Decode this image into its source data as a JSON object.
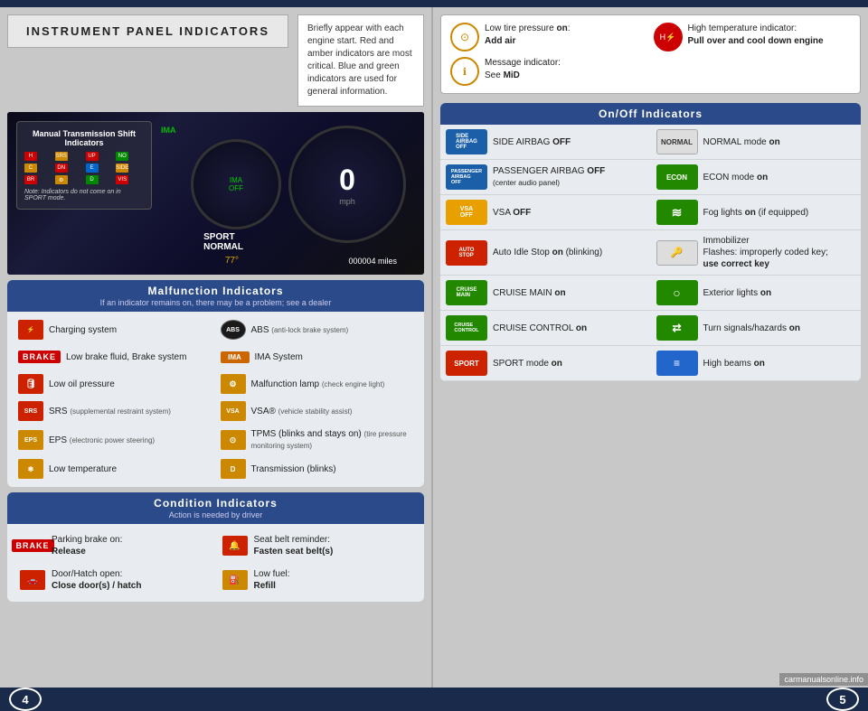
{
  "page": {
    "title": "INSTRUMENT PANEL INDICATORS",
    "note_text": "Briefly appear with each engine start. Red and amber indicators are most critical. Blue and green indicators are used for general information.",
    "page_left": "4",
    "page_right": "5"
  },
  "dashboard": {
    "overlay_title": "Manual Transmission Shift Indicators",
    "overlay_note": "Note: Indicators do not come on in SPORT mode.",
    "speed": "0",
    "speed_unit": "mph",
    "odometer": "000004"
  },
  "malfunction": {
    "section_title": "Malfunction Indicators",
    "section_subtitle": "If an indicator remains on, there may be a problem; see a dealer",
    "items_left": [
      {
        "label": "Charging system",
        "icon_type": "red-box"
      },
      {
        "label": "Low brake fluid, Brake system",
        "icon_type": "brake-badge"
      },
      {
        "label": "Low oil pressure",
        "icon_type": "red-oil"
      },
      {
        "label": "SRS",
        "sublabel": "(supplemental restraint system)",
        "icon_type": "red-srs"
      },
      {
        "label": "EPS",
        "sublabel": "(electronic power steering)",
        "icon_type": "amber-eps"
      },
      {
        "label": "Low temperature",
        "icon_type": "amber-temp"
      }
    ],
    "items_right": [
      {
        "label": "ABS",
        "sublabel": "(anti-lock brake system)",
        "icon_type": "abs-circle"
      },
      {
        "label": "IMA System",
        "icon_type": "ima-badge"
      },
      {
        "label": "Malfunction lamp",
        "sublabel": "(check engine light)",
        "icon_type": "amber-engine"
      },
      {
        "label": "VSA®",
        "sublabel": "(vehicle stability assist)",
        "icon_type": "amber-vsa"
      },
      {
        "label": "TPMS (blinks and stays on)",
        "sublabel": "(tire pressure monitoring system)",
        "icon_type": "amber-tpms"
      },
      {
        "label": "Transmission (blinks)",
        "icon_type": "amber-trans"
      }
    ]
  },
  "condition": {
    "section_title": "Condition Indicators",
    "section_subtitle": "Action is needed by driver",
    "items_left": [
      {
        "label": "Parking brake on:",
        "sublabel": "Release",
        "icon_type": "brake-badge"
      },
      {
        "label": "Door/Hatch open:",
        "sublabel": "Close door(s) / hatch",
        "icon_type": "door-icon"
      }
    ],
    "items_right": [
      {
        "label": "Seat belt reminder:",
        "sublabel": "Fasten seat belt(s)",
        "icon_type": "seatbelt-icon"
      },
      {
        "label": "Low fuel:",
        "sublabel": "Refill",
        "icon_type": "fuel-icon"
      }
    ]
  },
  "top_right": {
    "items": [
      {
        "label": "Low tire pressure on: Add air",
        "icon_type": "tire-amber"
      },
      {
        "label": "High temperature indicator: Pull over and cool down engine",
        "icon_type": "temp-red"
      },
      {
        "label": "Message indicator: See MiD",
        "icon_type": "info-amber"
      }
    ]
  },
  "on_off": {
    "section_title": "On/Off Indicators",
    "items": [
      {
        "label": "SIDE AIRBAG OFF",
        "icon_text": "SIDE AIRBAG OFF",
        "icon_class": "icon-airbag-side",
        "col": 0
      },
      {
        "label": "NORMAL mode on",
        "icon_text": "NORMAL",
        "icon_class": "icon-normal",
        "col": 1
      },
      {
        "label": "PASSENGER AIRBAG OFF (center audio panel)",
        "icon_text": "PASSENGER AIRBAG OFF",
        "icon_class": "icon-airbag-pass",
        "col": 0
      },
      {
        "label": "ECON mode on",
        "icon_text": "ECON",
        "icon_class": "icon-econ",
        "col": 1
      },
      {
        "label": "VSA OFF",
        "icon_text": "VSA OFF",
        "icon_class": "icon-vsa",
        "col": 0
      },
      {
        "label": "Fog lights on (if equipped)",
        "icon_text": "≋",
        "icon_class": "icon-fog",
        "col": 1
      },
      {
        "label": "Auto Idle Stop on (blinking)",
        "icon_text": "AUTO STOP",
        "icon_class": "icon-autostop",
        "col": 0
      },
      {
        "label": "Immobilizer Flashes: improperly coded key; use correct key",
        "icon_text": "🔑",
        "icon_class": "icon-immob",
        "col": 1
      },
      {
        "label": "CRUISE MAIN on",
        "icon_text": "CRUISE MAIN",
        "icon_class": "icon-cruise-main",
        "col": 0
      },
      {
        "label": "Exterior lights on",
        "icon_text": "○",
        "icon_class": "icon-exterior",
        "col": 1
      },
      {
        "label": "CRUISE CONTROL on",
        "icon_text": "CRUISE CONTROL",
        "icon_class": "icon-cruise-ctrl",
        "col": 0
      },
      {
        "label": "Turn signals/hazards on",
        "icon_text": "⇄",
        "icon_class": "icon-turn",
        "col": 1
      },
      {
        "label": "SPORT mode on",
        "icon_text": "SPORT",
        "icon_class": "icon-sport",
        "col": 0
      },
      {
        "label": "High beams on",
        "icon_text": "≡",
        "icon_class": "icon-highbeam",
        "col": 1
      }
    ]
  }
}
